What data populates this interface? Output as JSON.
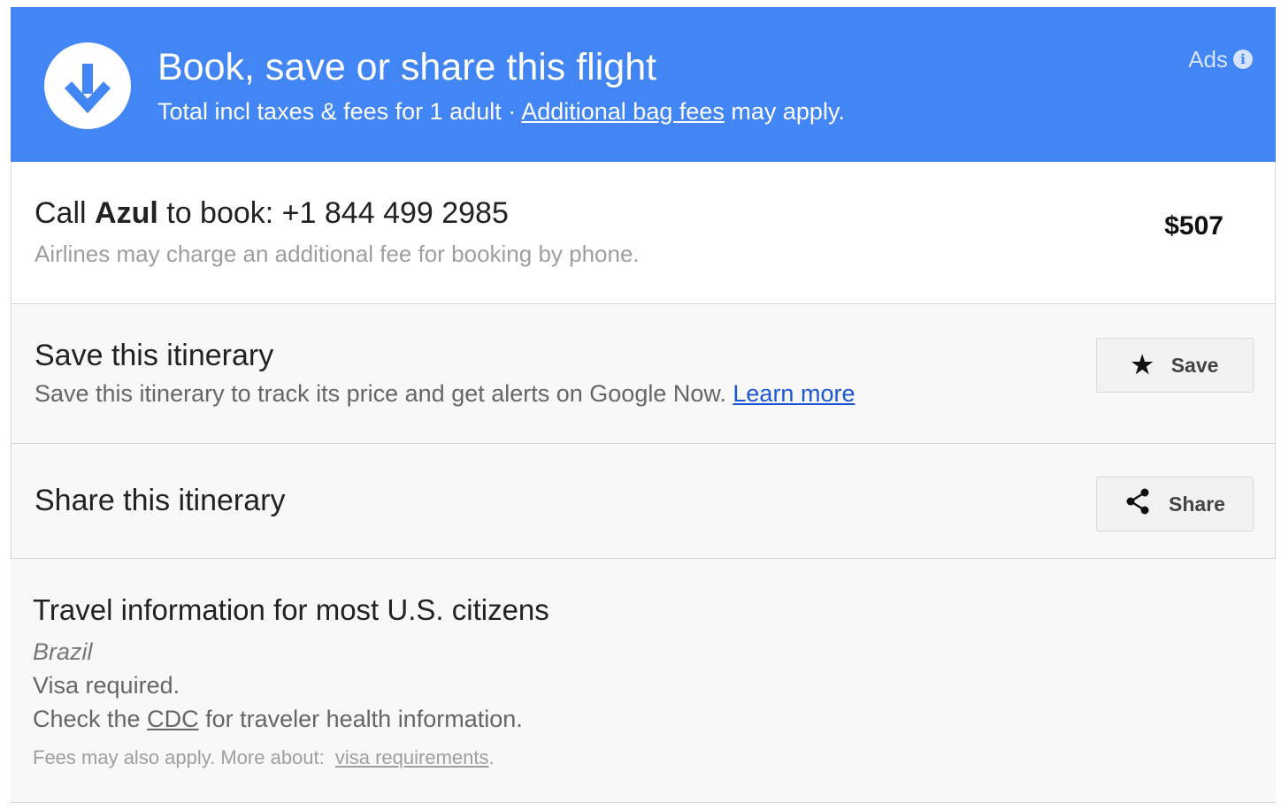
{
  "header": {
    "title": "Book, save or share this flight",
    "subtitle_prefix": "Total incl taxes & fees for 1 adult · ",
    "bag_fees_link": "Additional bag fees",
    "subtitle_suffix": " may apply.",
    "ads_label": "Ads",
    "info_icon": "i",
    "icon": "download-arrow-icon"
  },
  "call": {
    "prefix": "Call ",
    "airline": "Azul",
    "suffix": " to book: +1 844 499 2985",
    "note": "Airlines may charge an additional fee for booking by phone.",
    "price": "$507"
  },
  "save": {
    "title": "Save this itinerary",
    "description": "Save this itinerary to track its price and get alerts on Google Now. ",
    "learn_more": "Learn more",
    "button_label": "Save",
    "button_icon": "★"
  },
  "share": {
    "title": "Share this itinerary",
    "button_label": "Share",
    "button_icon": "share-icon"
  },
  "travel": {
    "title": "Travel information for most U.S. citizens",
    "country": "Brazil",
    "visa": "Visa required.",
    "cdc_prefix": "Check the ",
    "cdc_link": "CDC",
    "cdc_suffix": " for traveler health information.",
    "fees_text": "Fees may also apply. More about: ",
    "visa_link": "visa requirements",
    "fees_end": "."
  },
  "colors": {
    "header_bg": "#4285f4",
    "link_blue": "#1a56d6",
    "muted_text": "#9e9e9e"
  }
}
